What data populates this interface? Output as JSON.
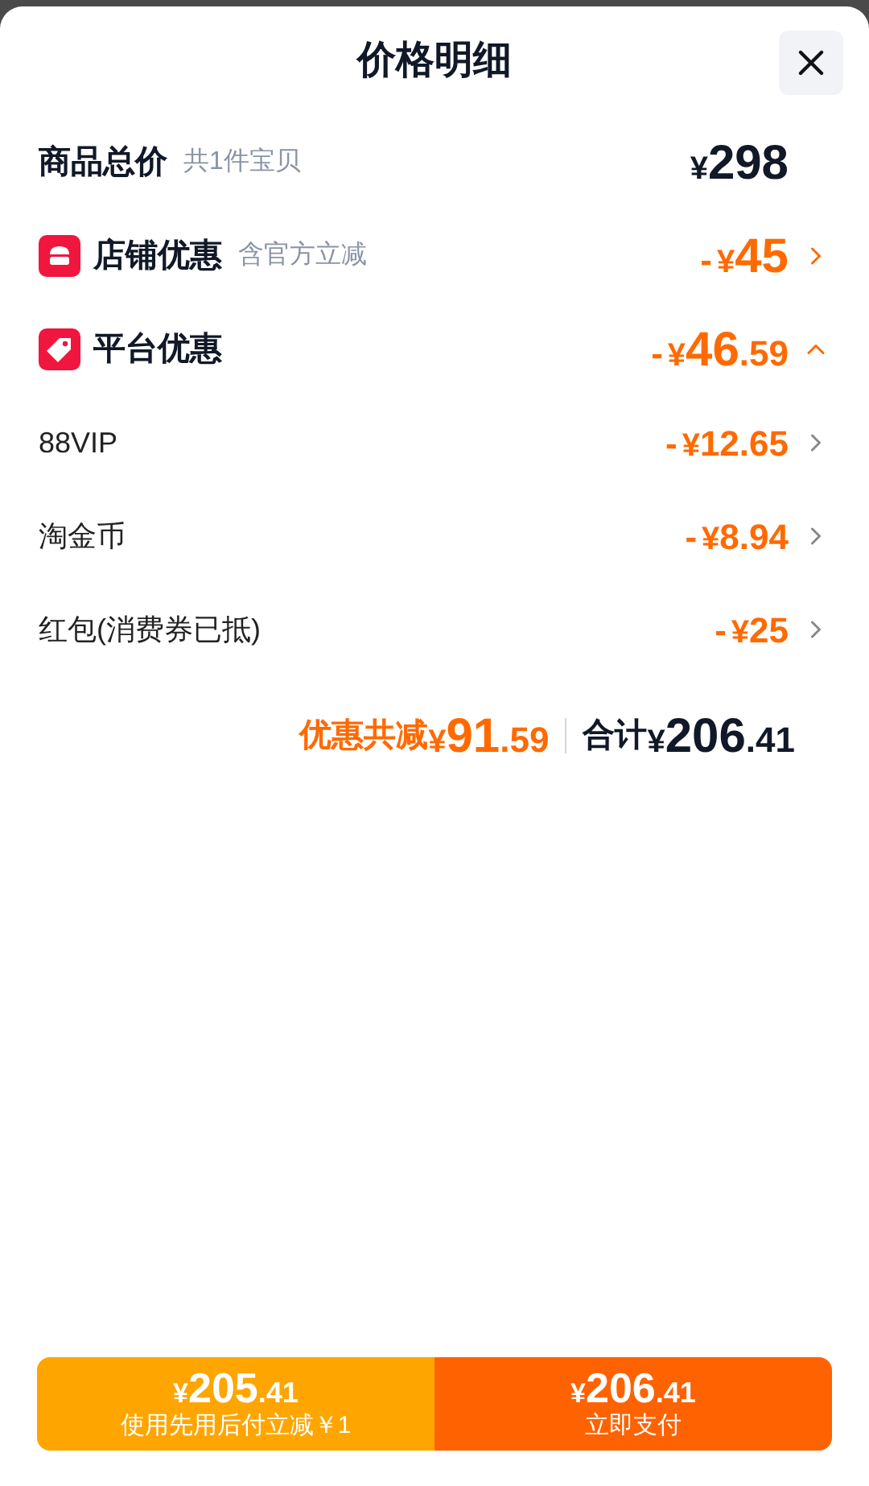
{
  "title": "价格明细",
  "rows": [
    {
      "kind": "total",
      "label": "商品总价",
      "note": "共1件宝贝",
      "amount": {
        "currency": "¥",
        "main": "298"
      }
    },
    {
      "kind": "store",
      "label": "店铺优惠",
      "note": "含官方立减",
      "expanded": false,
      "amount": {
        "sign": "-",
        "currency": "¥",
        "main": "45"
      }
    },
    {
      "kind": "platform",
      "label": "平台优惠",
      "expanded": true,
      "amount": {
        "sign": "-",
        "currency": "¥",
        "main": "46",
        "fraction": ".59"
      }
    },
    {
      "kind": "item",
      "label": "88VIP",
      "amount": {
        "sign": "-",
        "currency": "¥",
        "main": "12.65"
      }
    },
    {
      "kind": "item",
      "label": "淘金币",
      "amount": {
        "sign": "-",
        "currency": "¥",
        "main": "8.94"
      }
    },
    {
      "kind": "item",
      "label": "红包(消费券已抵)",
      "amount": {
        "sign": "-",
        "currency": "¥",
        "main": "25"
      }
    }
  ],
  "summary": {
    "discount_label": "优惠共减",
    "discount": {
      "currency": "¥",
      "main": "91",
      "fraction": ".59"
    },
    "total_label": "合计",
    "total": {
      "currency": "¥",
      "main": "206",
      "fraction": ".41"
    }
  },
  "buttons": [
    {
      "kind": "later",
      "price": {
        "currency": "¥",
        "main": "205",
        "fraction": ".41"
      },
      "caption": "使用先用后付立减￥1"
    },
    {
      "kind": "now",
      "price": {
        "currency": "¥",
        "main": "206",
        "fraction": ".41"
      },
      "caption": "立即支付"
    }
  ]
}
